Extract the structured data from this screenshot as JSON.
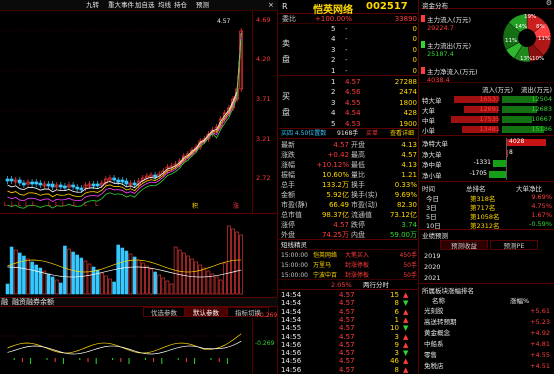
{
  "toolbar": {
    "items": [
      "九转",
      "重大事件",
      "加自选",
      "均线",
      "持仓",
      "预测"
    ],
    "close_glyph": "×"
  },
  "kline": {
    "price_labels": [
      "4.57",
      "4.69",
      "4.20",
      "3.71",
      "3.21",
      "2.72"
    ],
    "marker_labels": [
      "L",
      "L",
      "L",
      "L",
      "L",
      "L",
      "L",
      "L",
      "L",
      "L",
      "L",
      "L",
      "LL",
      "L",
      "L",
      "L",
      "L",
      "L",
      "L",
      "L"
    ],
    "buy_mark": "B",
    "sell_mark": "S",
    "tag_strong": "积",
    "tag_rise": "涨"
  },
  "sub_chart": {
    "tab_labels": [
      "融",
      "融资融券余额"
    ],
    "price_labels": [
      "+0.269",
      "-0.269"
    ]
  },
  "bottom_tabs": [
    "优选参数",
    "默认参数",
    "指标切换"
  ],
  "stock": {
    "code_flag": "R",
    "name": "恺英网络",
    "code": "002517"
  },
  "book": {
    "header_label": "委比",
    "ratio": "+100.00%",
    "diff": "33890",
    "sells": [
      {
        "l": "5",
        "p": "-",
        "v": "0"
      },
      {
        "l": "4",
        "p": "-",
        "v": "0"
      },
      {
        "l": "3",
        "p": "-",
        "v": "0"
      },
      {
        "l": "2",
        "p": "-",
        "v": "0"
      },
      {
        "l": "1",
        "p": "-",
        "v": "0"
      }
    ],
    "sell_side": [
      "卖",
      "盘"
    ],
    "buy_side": [
      "买",
      "盘"
    ],
    "buys": [
      {
        "l": "1",
        "p": "4.57",
        "v": "27288"
      },
      {
        "l": "2",
        "p": "4.56",
        "v": "2474"
      },
      {
        "l": "3",
        "p": "4.55",
        "v": "1800"
      },
      {
        "l": "4",
        "p": "4.54",
        "v": "428"
      },
      {
        "l": "5",
        "p": "4.53",
        "v": "1900"
      }
    ],
    "summary_left": "买四 4.50位置数",
    "summary_mid": "9168手",
    "summary_tag": "买单",
    "summary_btn": "查看详细"
  },
  "quote": {
    "left": [
      {
        "k": "最新",
        "v": "4.57"
      },
      {
        "k": "涨跌",
        "v": "+0.42"
      },
      {
        "k": "涨幅",
        "v": "+10.12%"
      },
      {
        "k": "振幅",
        "v": "10.60%"
      },
      {
        "k": "总手",
        "v": "133.2万"
      },
      {
        "k": "金额",
        "v": "5.92亿"
      },
      {
        "k": "市盈(静)",
        "v": "66.49"
      },
      {
        "k": "总市值",
        "v": "98.37亿"
      },
      {
        "k": "涨停",
        "v": "4.57"
      },
      {
        "k": "外盘",
        "v": "74.25万"
      }
    ],
    "right": [
      {
        "k": "开盘",
        "v": "4.13"
      },
      {
        "k": "最高",
        "v": "4.57"
      },
      {
        "k": "最低",
        "v": "4.13"
      },
      {
        "k": "量比",
        "v": "1.21"
      },
      {
        "k": "换手",
        "v": "0.33%"
      },
      {
        "k": "换手(实)",
        "v": "9.69%"
      },
      {
        "k": "市盈(动)",
        "v": "82.30"
      },
      {
        "k": "流通值",
        "v": "73.12亿"
      },
      {
        "k": "跌停",
        "v": "3.74"
      },
      {
        "k": "内盘",
        "v": "59.00万"
      }
    ]
  },
  "tick_header": {
    "tab1": "短线精灵",
    "pct": "2.05%",
    "tab2": "两行分时"
  },
  "ticks_top": [
    {
      "t": "15:00:00",
      "s": "恺英网络",
      "a": "大笔买入",
      "n": "450手"
    },
    {
      "t": "15:00:00",
      "s": "万里马",
      "a": "封涨停板",
      "n": "50手"
    },
    {
      "t": "15:00:00",
      "s": "宁波中百",
      "a": "封涨停板",
      "n": "50手"
    }
  ],
  "trades": [
    {
      "t": "14:54",
      "p": "4.57",
      "v": "15"
    },
    {
      "t": "14:54",
      "p": "4.57",
      "v": "8"
    },
    {
      "t": "14:54",
      "p": "4.57",
      "v": "6"
    },
    {
      "t": "14:54",
      "p": "4.57",
      "v": "1"
    },
    {
      "t": "14:55",
      "p": "4.57",
      "v": "10"
    },
    {
      "t": "14:55",
      "p": "4.57",
      "v": "3"
    },
    {
      "t": "14:56",
      "p": "4.57",
      "v": "9"
    },
    {
      "t": "14:56",
      "p": "4.57",
      "v": "3"
    },
    {
      "t": "14:56",
      "p": "4.57",
      "v": "46"
    },
    {
      "t": "14:56",
      "p": "4.57",
      "v": "8"
    }
  ],
  "flow": {
    "tab": "资金分布",
    "legend": [
      {
        "k": "主力流入(万元)",
        "v": "29224.7"
      },
      {
        "k": "主力流出(万元)",
        "v": "25187.4"
      },
      {
        "k": "主力净流入(万元)",
        "v": "4038.4"
      }
    ],
    "pie_labels": [
      "14%",
      "11%",
      "13%",
      "10%",
      "11%",
      "8%",
      "19%"
    ],
    "table_header": [
      "流入(万元)",
      "流出(万元)"
    ],
    "rows": [
      {
        "k": "特大单",
        "in": "16533",
        "out": "12504"
      },
      {
        "k": "大单",
        "in": "12691",
        "out": "12683"
      },
      {
        "k": "中单",
        "in": "17535",
        "out": "10667"
      },
      {
        "k": "小单",
        "in": "13481",
        "out": "15186"
      }
    ]
  },
  "net": {
    "rows": [
      {
        "k": "净特大单",
        "v": "4028"
      },
      {
        "k": "净大单",
        "v": "8"
      },
      {
        "k": "净中单",
        "v": "-1331"
      },
      {
        "k": "净小单",
        "v": "-1705"
      }
    ]
  },
  "rank": {
    "headers": [
      "时间",
      "总排名",
      "大单净比"
    ],
    "rows": [
      {
        "k": "今日",
        "r": "第318名",
        "v": "9.69%"
      },
      {
        "k": "3日",
        "r": "第717名",
        "v": "4.75%"
      },
      {
        "k": "5日",
        "r": "第1058名",
        "v": "1.67%"
      },
      {
        "k": "10日",
        "r": "第2312名",
        "v": "-0.59%"
      }
    ]
  },
  "forecast": {
    "title": "业绩预测",
    "tabs": [
      "预测收益",
      "预测PE"
    ],
    "years": [
      "2019",
      "2020",
      "2021"
    ]
  },
  "sectors": {
    "title": "所属板块涨幅排名",
    "headers": [
      "名称",
      "涨幅%"
    ],
    "rows": [
      {
        "n": "光刻胶",
        "v": "+5.61"
      },
      {
        "n": "高送转预期",
        "v": "+5.23"
      },
      {
        "n": "黄金概念",
        "v": "+4.92"
      },
      {
        "n": "中船系",
        "v": "+4.81"
      },
      {
        "n": "零售",
        "v": "+4.55"
      },
      {
        "n": "免税店",
        "v": "+4.51"
      }
    ]
  },
  "colors": {
    "up": "#ff3c3c",
    "down": "#2fd72f",
    "text": "#c8c8c8",
    "bg": "#000000"
  }
}
